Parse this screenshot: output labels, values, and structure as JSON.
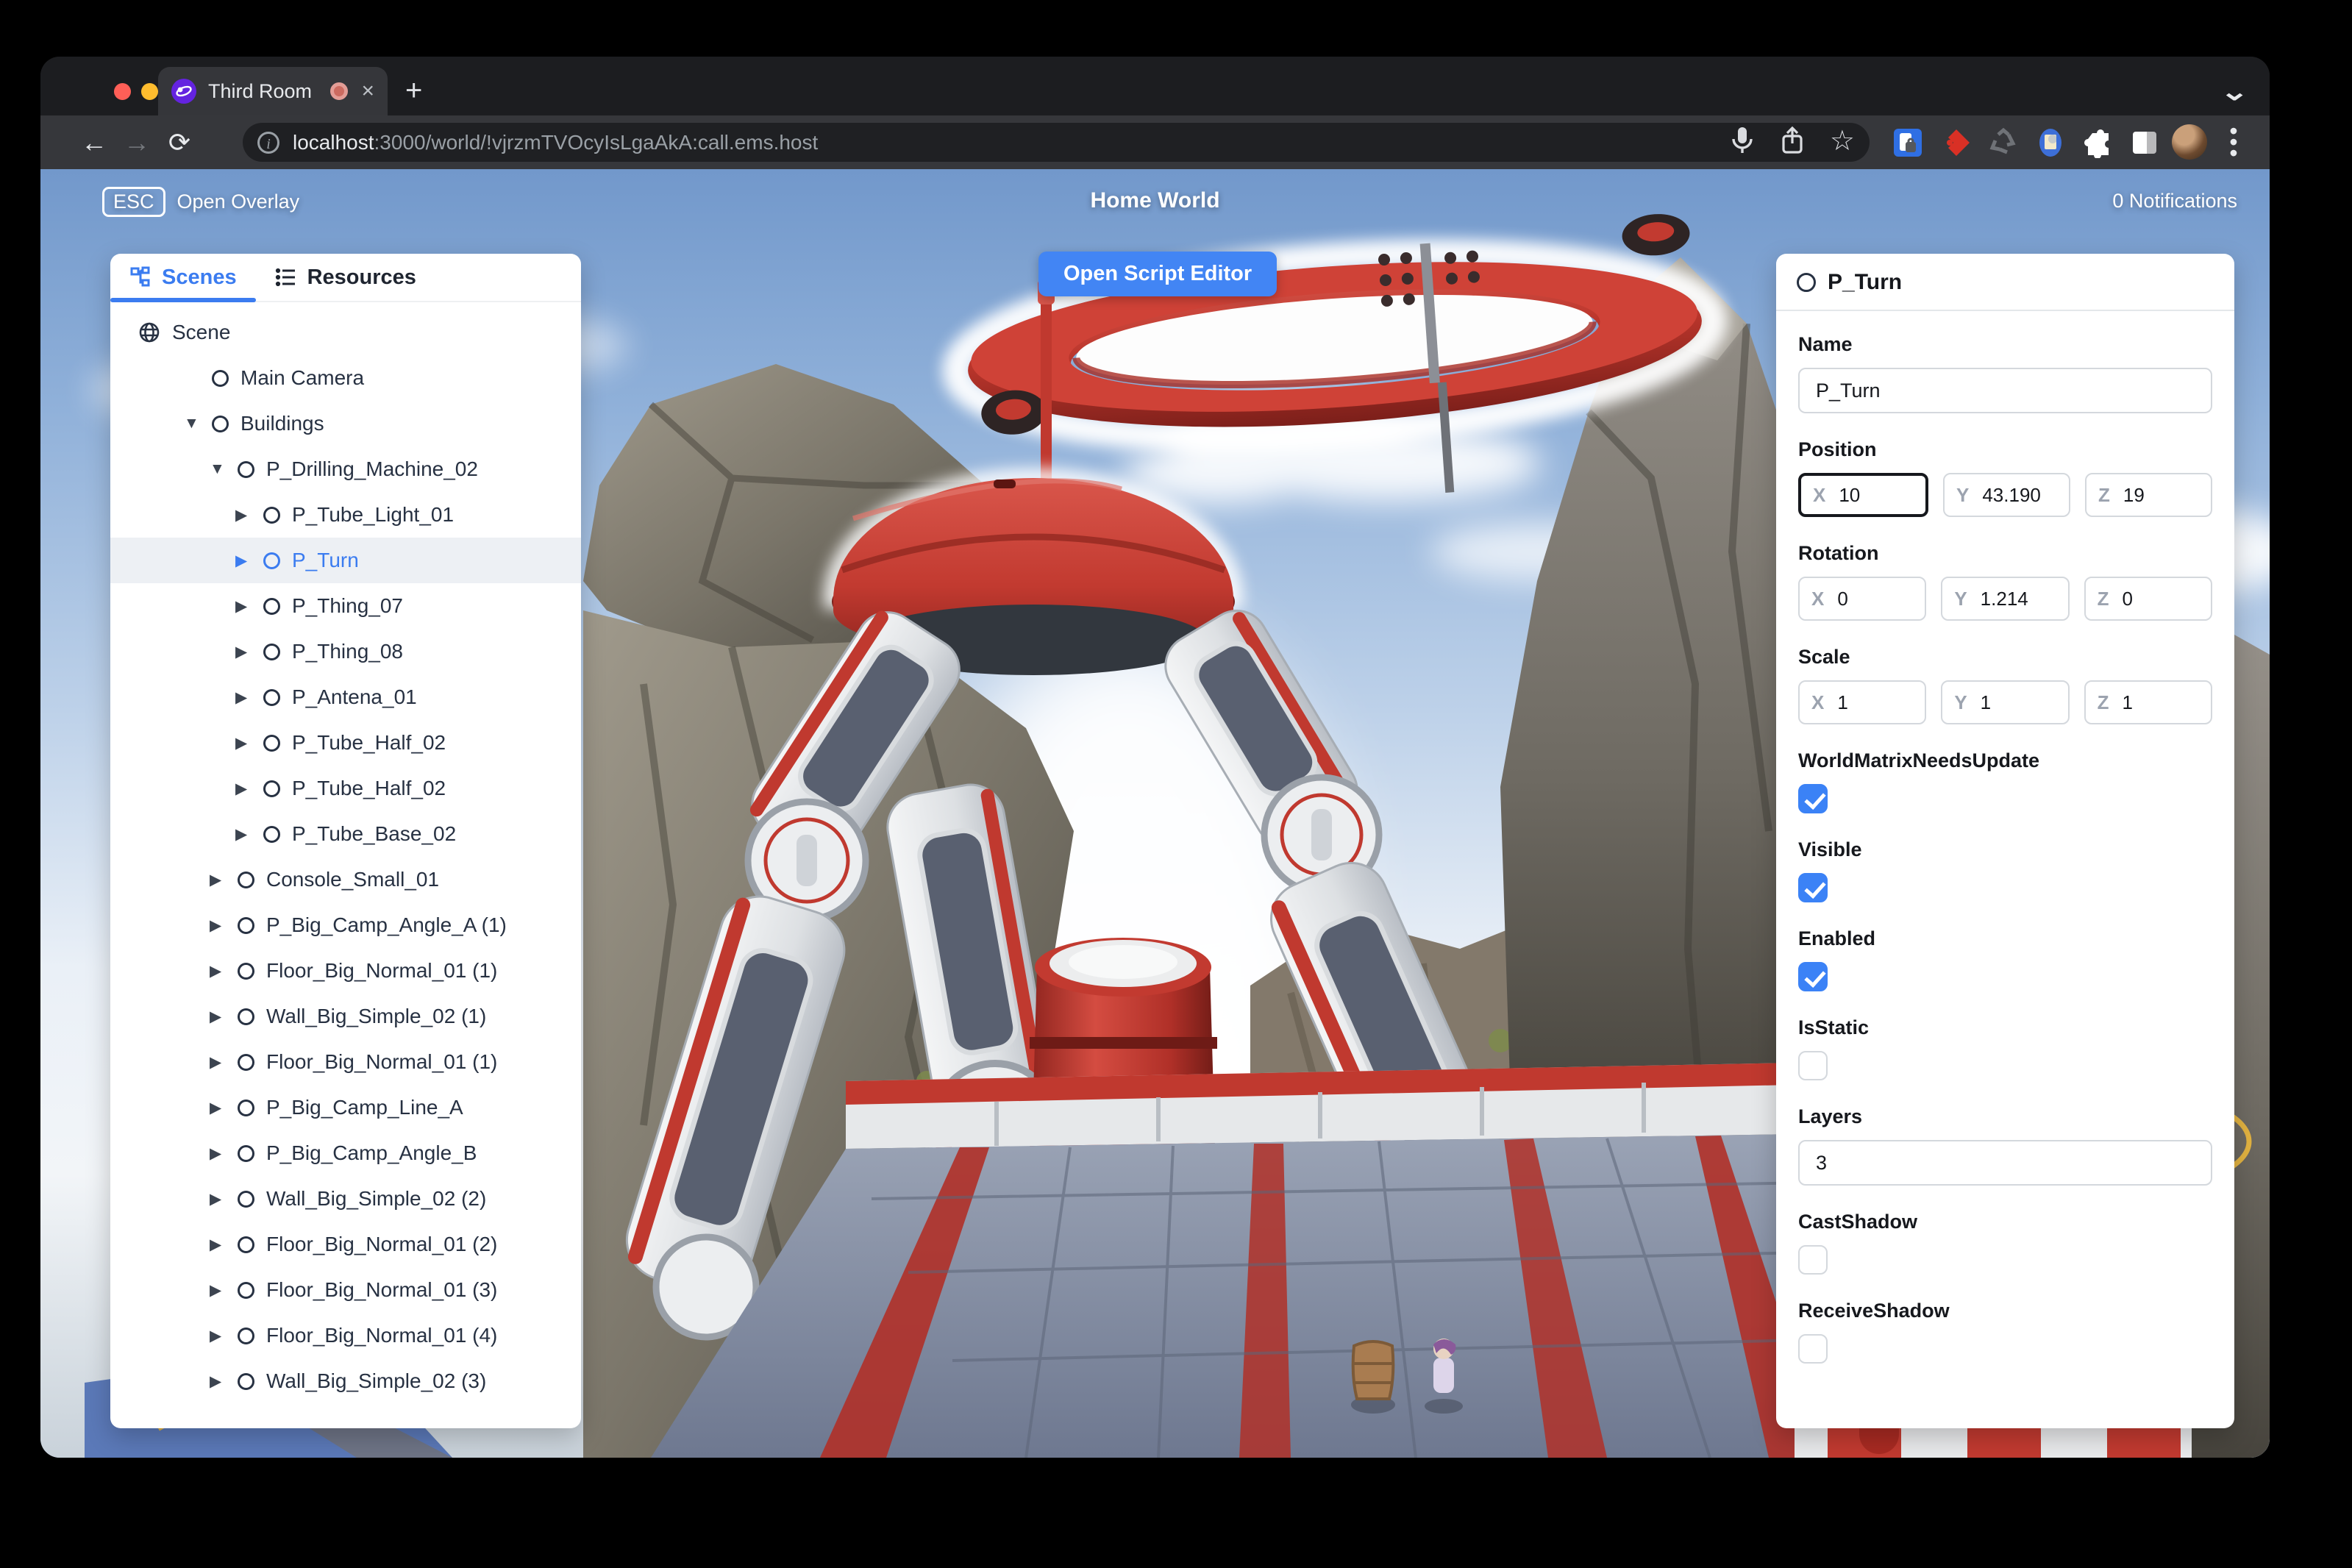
{
  "browser": {
    "tab_title": "Third Room",
    "new_tab": "+",
    "url_host": "localhost",
    "url_rest": ":3000/world/!vjrzmTVOcyIsLgaAkA:call.ems.host",
    "back": "←",
    "forward": "→",
    "reload": "⟳",
    "info": "i",
    "star": "☆",
    "close_tab": "×",
    "kebab": "⋮",
    "chevron": "⌄"
  },
  "hud": {
    "esc_key": "ESC",
    "open_overlay": "Open Overlay",
    "world_title": "Home World",
    "notifications": "0 Notifications",
    "open_script_editor": "Open Script Editor"
  },
  "sidebar": {
    "tabs": [
      {
        "label": "Scenes",
        "active": true
      },
      {
        "label": "Resources",
        "active": false
      }
    ],
    "tree": [
      {
        "label": "Scene",
        "depth": 0,
        "caret": "",
        "icon": "globe",
        "selected": false
      },
      {
        "label": "Main Camera",
        "depth": 1,
        "caret": "",
        "icon": "node",
        "selected": false
      },
      {
        "label": "Buildings",
        "depth": 1,
        "caret": "▼",
        "icon": "node",
        "selected": false
      },
      {
        "label": "P_Drilling_Machine_02",
        "depth": 2,
        "caret": "▼",
        "icon": "node",
        "selected": false
      },
      {
        "label": "P_Tube_Light_01",
        "depth": 3,
        "caret": "▶",
        "icon": "node",
        "selected": false
      },
      {
        "label": "P_Turn",
        "depth": 3,
        "caret": "▶",
        "icon": "node",
        "selected": true
      },
      {
        "label": "P_Thing_07",
        "depth": 3,
        "caret": "▶",
        "icon": "node",
        "selected": false
      },
      {
        "label": "P_Thing_08",
        "depth": 3,
        "caret": "▶",
        "icon": "node",
        "selected": false
      },
      {
        "label": "P_Antena_01",
        "depth": 3,
        "caret": "▶",
        "icon": "node",
        "selected": false
      },
      {
        "label": "P_Tube_Half_02",
        "depth": 3,
        "caret": "▶",
        "icon": "node",
        "selected": false
      },
      {
        "label": "P_Tube_Half_02",
        "depth": 3,
        "caret": "▶",
        "icon": "node",
        "selected": false
      },
      {
        "label": "P_Tube_Base_02",
        "depth": 3,
        "caret": "▶",
        "icon": "node",
        "selected": false
      },
      {
        "label": "Console_Small_01",
        "depth": 2,
        "caret": "▶",
        "icon": "node",
        "selected": false
      },
      {
        "label": "P_Big_Camp_Angle_A (1)",
        "depth": 2,
        "caret": "▶",
        "icon": "node",
        "selected": false
      },
      {
        "label": "Floor_Big_Normal_01 (1)",
        "depth": 2,
        "caret": "▶",
        "icon": "node",
        "selected": false
      },
      {
        "label": "Wall_Big_Simple_02 (1)",
        "depth": 2,
        "caret": "▶",
        "icon": "node",
        "selected": false
      },
      {
        "label": "Floor_Big_Normal_01 (1)",
        "depth": 2,
        "caret": "▶",
        "icon": "node",
        "selected": false
      },
      {
        "label": "P_Big_Camp_Line_A",
        "depth": 2,
        "caret": "▶",
        "icon": "node",
        "selected": false
      },
      {
        "label": "P_Big_Camp_Angle_B",
        "depth": 2,
        "caret": "▶",
        "icon": "node",
        "selected": false
      },
      {
        "label": "Wall_Big_Simple_02 (2)",
        "depth": 2,
        "caret": "▶",
        "icon": "node",
        "selected": false
      },
      {
        "label": "Floor_Big_Normal_01 (2)",
        "depth": 2,
        "caret": "▶",
        "icon": "node",
        "selected": false
      },
      {
        "label": "Floor_Big_Normal_01 (3)",
        "depth": 2,
        "caret": "▶",
        "icon": "node",
        "selected": false
      },
      {
        "label": "Floor_Big_Normal_01 (4)",
        "depth": 2,
        "caret": "▶",
        "icon": "node",
        "selected": false
      },
      {
        "label": "Wall_Big_Simple_02 (3)",
        "depth": 2,
        "caret": "▶",
        "icon": "node",
        "selected": false
      }
    ]
  },
  "inspector": {
    "title": "P_Turn",
    "axes": [
      "X",
      "Y",
      "Z"
    ],
    "name": {
      "label": "Name",
      "value": "P_Turn"
    },
    "position": {
      "label": "Position",
      "x": "10",
      "y": "43.190",
      "z": "19"
    },
    "rotation": {
      "label": "Rotation",
      "x": "0",
      "y": "1.214",
      "z": "0"
    },
    "scale": {
      "label": "Scale",
      "x": "1",
      "y": "1",
      "z": "1"
    },
    "checks": [
      {
        "label": "WorldMatrixNeedsUpdate",
        "checked": true
      },
      {
        "label": "Visible",
        "checked": true
      },
      {
        "label": "Enabled",
        "checked": true
      },
      {
        "label": "IsStatic",
        "checked": false
      }
    ],
    "layers": {
      "label": "Layers",
      "value": "3"
    },
    "shadow_checks": [
      {
        "label": "CastShadow",
        "checked": false
      },
      {
        "label": "ReceiveShadow",
        "checked": false
      }
    ]
  },
  "colors": {
    "accent": "#3b82f6",
    "button": "#4285f4",
    "selected_text": "#3b7cf0",
    "machine_red": "#c23a30",
    "traffic": [
      "#ff5f57",
      "#febc2e",
      "#28c840"
    ]
  }
}
